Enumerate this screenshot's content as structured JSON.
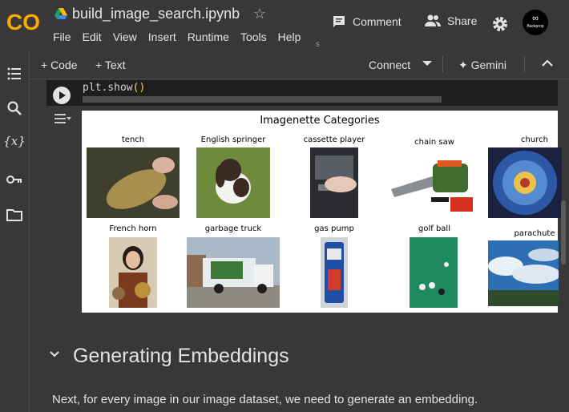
{
  "header": {
    "notebook_title": "build_image_search.ipynb",
    "menu": [
      "File",
      "Edit",
      "View",
      "Insert",
      "Runtime",
      "Tools",
      "Help"
    ],
    "menu_trailing": "s",
    "comment_label": "Comment",
    "share_label": "Share",
    "avatar_text": "Backprop"
  },
  "toolbar": {
    "add_code_label": "+ Code",
    "add_text_label": "+ Text",
    "connect_label": "Connect",
    "gemini_label": "Gemini"
  },
  "code_cell": {
    "code_prefix": "plt.show",
    "code_parens": "()"
  },
  "figure": {
    "title": "Imagenette Categories",
    "categories": [
      "tench",
      "English springer",
      "cassette player",
      "chain saw",
      "church",
      "French horn",
      "garbage truck",
      "gas pump",
      "golf ball",
      "parachute"
    ]
  },
  "section": {
    "heading": "Generating Embeddings",
    "body": "Next, for every image in our image dataset, we need to generate an embedding."
  },
  "sidebar": {
    "icons": [
      "table-of-contents-icon",
      "search-icon",
      "variables-icon",
      "secrets-key-icon",
      "files-folder-icon"
    ]
  },
  "colors": {
    "background": "#383838",
    "code_bg": "#1e1e1e",
    "logo_orange": "#f9ab00",
    "logo_dark_orange": "#e8710a"
  }
}
